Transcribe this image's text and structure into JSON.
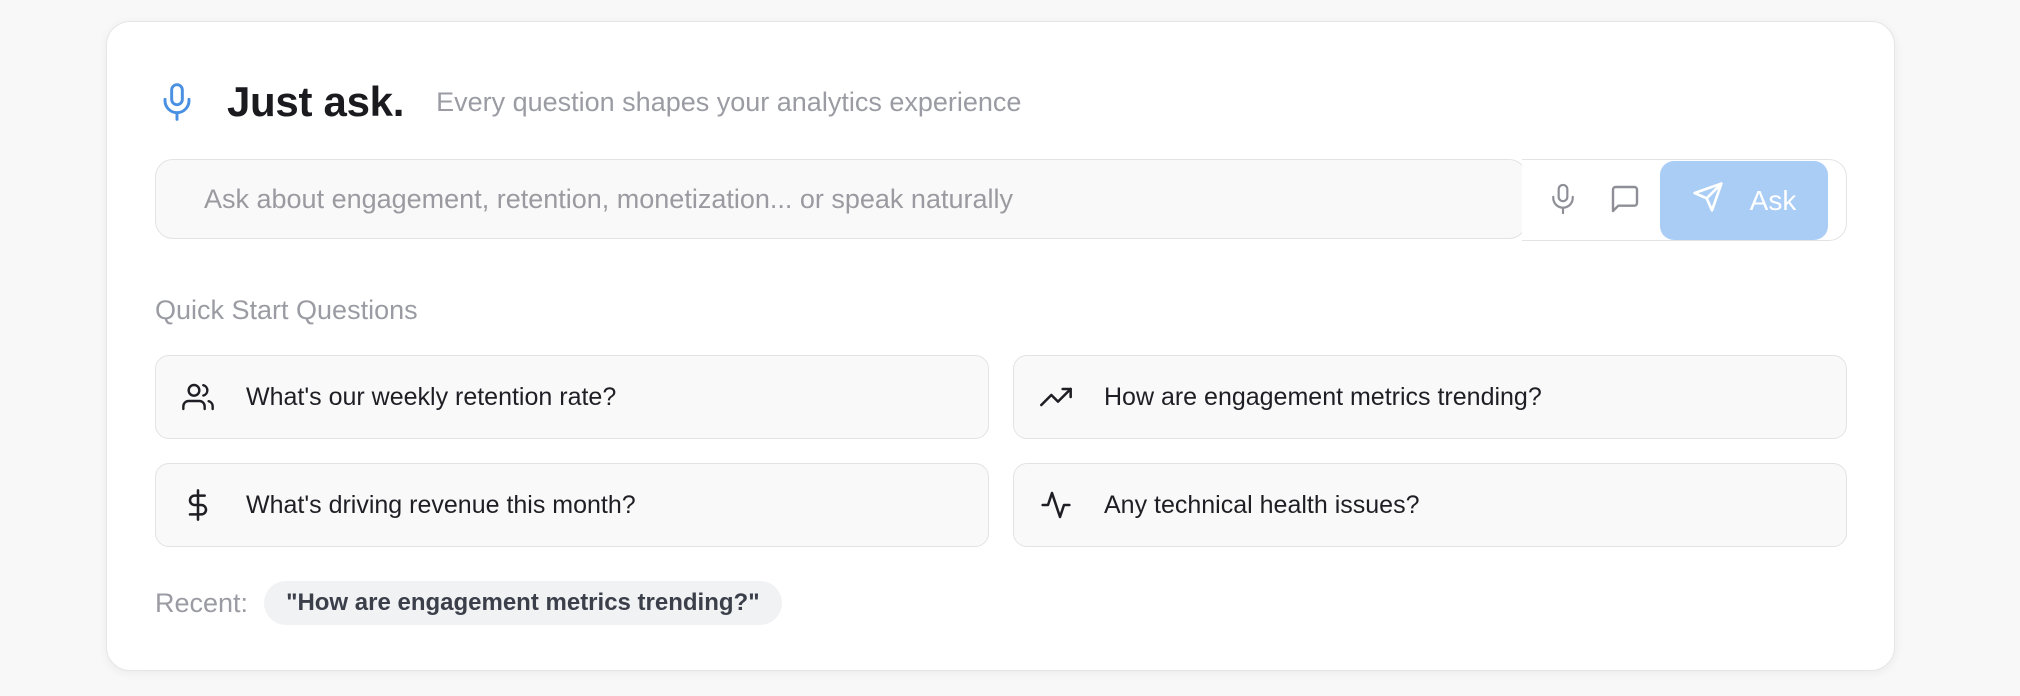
{
  "header": {
    "title": "Just ask.",
    "subtitle": "Every question shapes your analytics experience",
    "icon": "microphone-icon"
  },
  "ask_bar": {
    "placeholder": "Ask about engagement, retention, monetization... or speak naturally",
    "value": "",
    "voice_icon": "microphone-icon",
    "chat_icon": "chat-bubble-icon",
    "submit_label": "Ask",
    "submit_icon": "send-icon"
  },
  "quick_start": {
    "title": "Quick Start Questions",
    "items": [
      {
        "label": "What's our weekly retention rate?",
        "icon": "users-icon"
      },
      {
        "label": "How are engagement metrics trending?",
        "icon": "trending-up-icon"
      },
      {
        "label": "What's driving revenue this month?",
        "icon": "dollar-icon"
      },
      {
        "label": "Any technical health issues?",
        "icon": "activity-icon"
      }
    ]
  },
  "recent": {
    "label": "Recent:",
    "items": [
      "\"How are engagement metrics trending?\""
    ]
  },
  "colors": {
    "accent": "#4a90e2",
    "ask_button": "#a9cdf5",
    "muted_text": "#9b9ca3"
  }
}
